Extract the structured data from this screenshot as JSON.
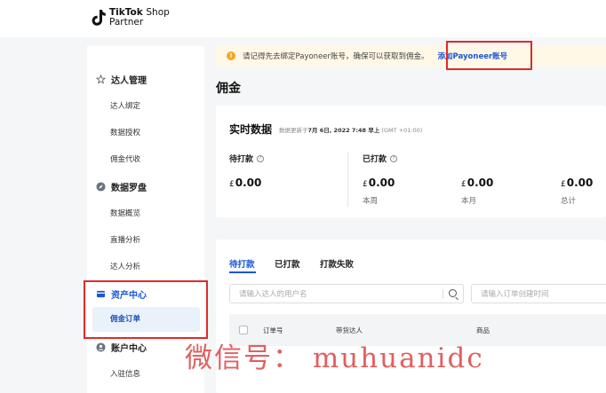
{
  "header": {
    "logo_brand": "TikTok",
    "logo_suffix": "Shop",
    "logo_sub": "Partner"
  },
  "sidebar": {
    "groups": [
      {
        "label": "达人管理",
        "items": [
          "达人绑定",
          "数据授权",
          "佣金代收"
        ]
      },
      {
        "label": "数据罗盘",
        "items": [
          "数据概览",
          "直播分析",
          "达人分析"
        ]
      },
      {
        "label": "资产中心",
        "items": [
          "佣金订单"
        ]
      },
      {
        "label": "账户中心",
        "items": [
          "入驻信息"
        ]
      }
    ],
    "active_item": "佣金订单"
  },
  "notice": {
    "text": "请记得先去绑定Payoneer账号，确保可以获取到佣金。",
    "link": "添加Payoneer账号",
    "icon": "!"
  },
  "page_title": "佣金",
  "realtime": {
    "title": "实时数据",
    "update_prefix": "数据更新于",
    "update_time": "7月 6日, 2022 7:48 早上",
    "timezone": "(GMT +01:00)",
    "pending_label": "待打款",
    "paid_label": "已打款",
    "currency": "£",
    "pending_value": "0.00",
    "paid": [
      {
        "value": "0.00",
        "caption": "本周"
      },
      {
        "value": "0.00",
        "caption": "本月"
      },
      {
        "value": "0.00",
        "caption": "总计"
      }
    ]
  },
  "orders": {
    "tabs": [
      "待打款",
      "已打款",
      "打款失败"
    ],
    "search_placeholder": "请输入达人的用户名",
    "date_placeholder": "请输入订单创建时间",
    "columns": [
      "订单号",
      "带货达人",
      "商品"
    ]
  },
  "watermark": "微信号： muhuanidc",
  "colors": {
    "accent": "#1a56d6",
    "highlight_box": "#e02a2a",
    "notice_bg": "#fff8e6"
  }
}
